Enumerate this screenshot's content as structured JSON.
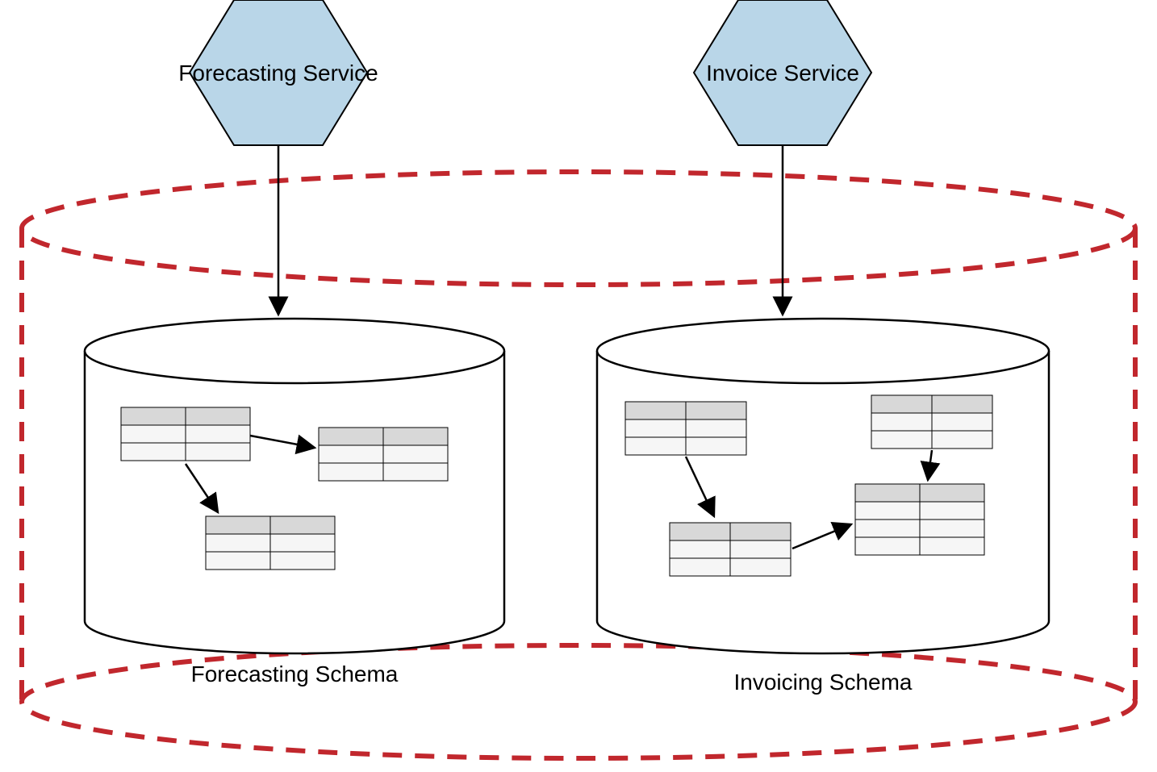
{
  "services": {
    "left": {
      "label": "Forecasting Service"
    },
    "right": {
      "label": "Invoice Service"
    }
  },
  "schemas": {
    "left": {
      "label": "Forecasting Schema"
    },
    "right": {
      "label": "Invoicing Schema"
    }
  }
}
